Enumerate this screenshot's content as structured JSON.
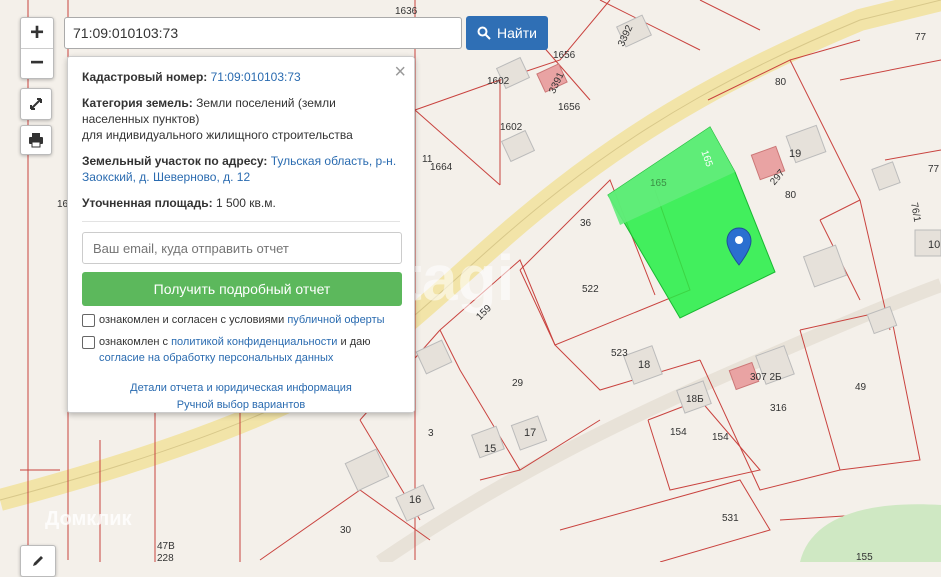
{
  "search": {
    "value": "71:09:010103:73",
    "button_label": "Найти"
  },
  "zoom": {
    "in": "+",
    "out": "−"
  },
  "popup": {
    "cad_label": "Кадастровый номер:",
    "cad_value": "71:09:010103:73",
    "cat_label": "Категория земель:",
    "cat_value_1": "Земли поселений (земли",
    "cat_value_2": "населенных пунктов)",
    "cat_value_3": "для индивидуального жилищного строительства",
    "addr_label": "Земельный участок по адресу:",
    "addr_value_1": "Тульская область, р-н.",
    "addr_value_2": "Заокский, д. Шеверново, д. 12",
    "area_label": "Уточненная площадь:",
    "area_value": "1 500 кв.м.",
    "email_placeholder": "Ваш email, куда отправить отчет",
    "report_button": "Получить подробный отчет",
    "agree1_text": "ознакомлен и согласен с условиями",
    "agree1_link": "публичной оферты",
    "agree2_text": "ознакомлен с",
    "agree2_link": "политикой конфиденциальности",
    "agree2_text2": "и даю",
    "agree2_link2": "согласие на обработку персональных данных",
    "link_details": "Детали отчета и юридическая информация",
    "link_manual": "Ручной выбор вариантов",
    "close": "×"
  },
  "map_labels": {
    "l1636": "1636",
    "l1656": "1656",
    "l1602a": "1602",
    "l1602b": "1602",
    "l3391": "3391",
    "l1656b": "1656",
    "l3392": "3392",
    "l77": "77",
    "l80a": "80",
    "l80b": "80",
    "l19": "19",
    "l297": "297",
    "l165a": "165",
    "l165b": "165",
    "l11": "11",
    "l1664": "1664",
    "l36": "36",
    "l522": "522",
    "l159": "159",
    "l523": "523",
    "l18": "18",
    "l29": "29",
    "l18b": "18Б",
    "l3072b": "307 2Б",
    "l316": "316",
    "l49": "49",
    "l154a": "154",
    "l154b": "154",
    "l3": "3",
    "l15": "15",
    "l17": "17",
    "l16": "16",
    "l30": "30",
    "l531": "531",
    "l47b": "47В",
    "l228": "228",
    "l155": "155",
    "l77b": "77",
    "l761": "76/1",
    "l10": "10",
    "l16b": "16"
  },
  "watermark": {
    "main": "etagi",
    "bottom": "Домклик"
  },
  "colors": {
    "parcel_green": "#22ee44",
    "accent": "#2f6fb5",
    "report_green": "#5cb85c"
  }
}
